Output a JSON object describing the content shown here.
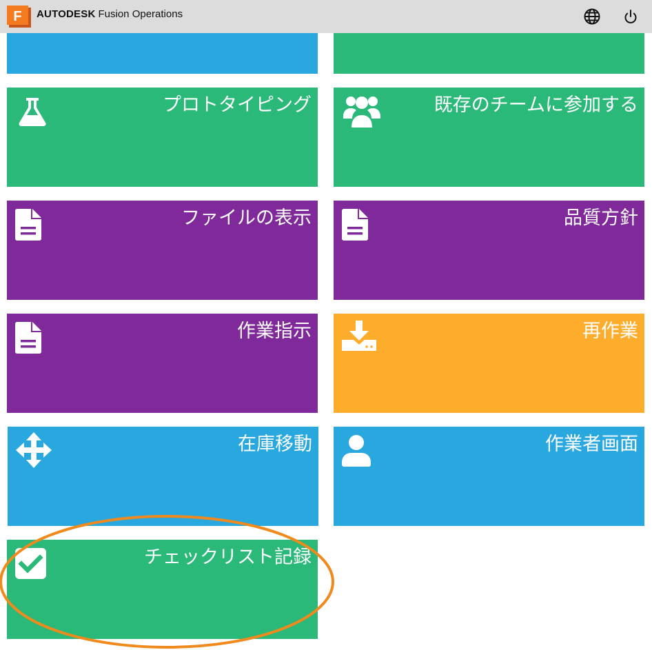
{
  "header": {
    "logo_letter": "F",
    "brand_bold": "AUTODESK",
    "brand_product": "Fusion Operations",
    "icons": [
      "globe-icon",
      "power-icon"
    ]
  },
  "colors": {
    "header_bg": "#dcdcdc",
    "blue": "#29a8e0",
    "green": "#2bb97a",
    "purple": "#80299a",
    "orange": "#fdad2b",
    "annotation": "#f08a1c"
  },
  "tiles": [
    {
      "id": "top-left",
      "label": "",
      "color": "blue",
      "icon": ""
    },
    {
      "id": "top-right",
      "label": "",
      "color": "green",
      "icon": ""
    },
    {
      "id": "prototyping",
      "label": "プロトタイピング",
      "color": "green",
      "icon": "flask-icon"
    },
    {
      "id": "join-team",
      "label": "既存のチームに参加する",
      "color": "green",
      "icon": "users-icon"
    },
    {
      "id": "view-files",
      "label": "ファイルの表示",
      "color": "purple",
      "icon": "document-icon"
    },
    {
      "id": "quality-policy",
      "label": "品質方針",
      "color": "purple",
      "icon": "document-icon"
    },
    {
      "id": "work-instructions",
      "label": "作業指示",
      "color": "purple",
      "icon": "document-icon"
    },
    {
      "id": "rework",
      "label": "再作業",
      "color": "orange",
      "icon": "download-tray-icon"
    },
    {
      "id": "inventory-move",
      "label": "在庫移動",
      "color": "blue",
      "icon": "move-arrows-icon"
    },
    {
      "id": "operator-screen",
      "label": "作業者画面",
      "color": "blue",
      "icon": "user-icon"
    },
    {
      "id": "checklist-record",
      "label": "チェックリスト記録",
      "color": "green",
      "icon": "checkbox-icon"
    }
  ]
}
